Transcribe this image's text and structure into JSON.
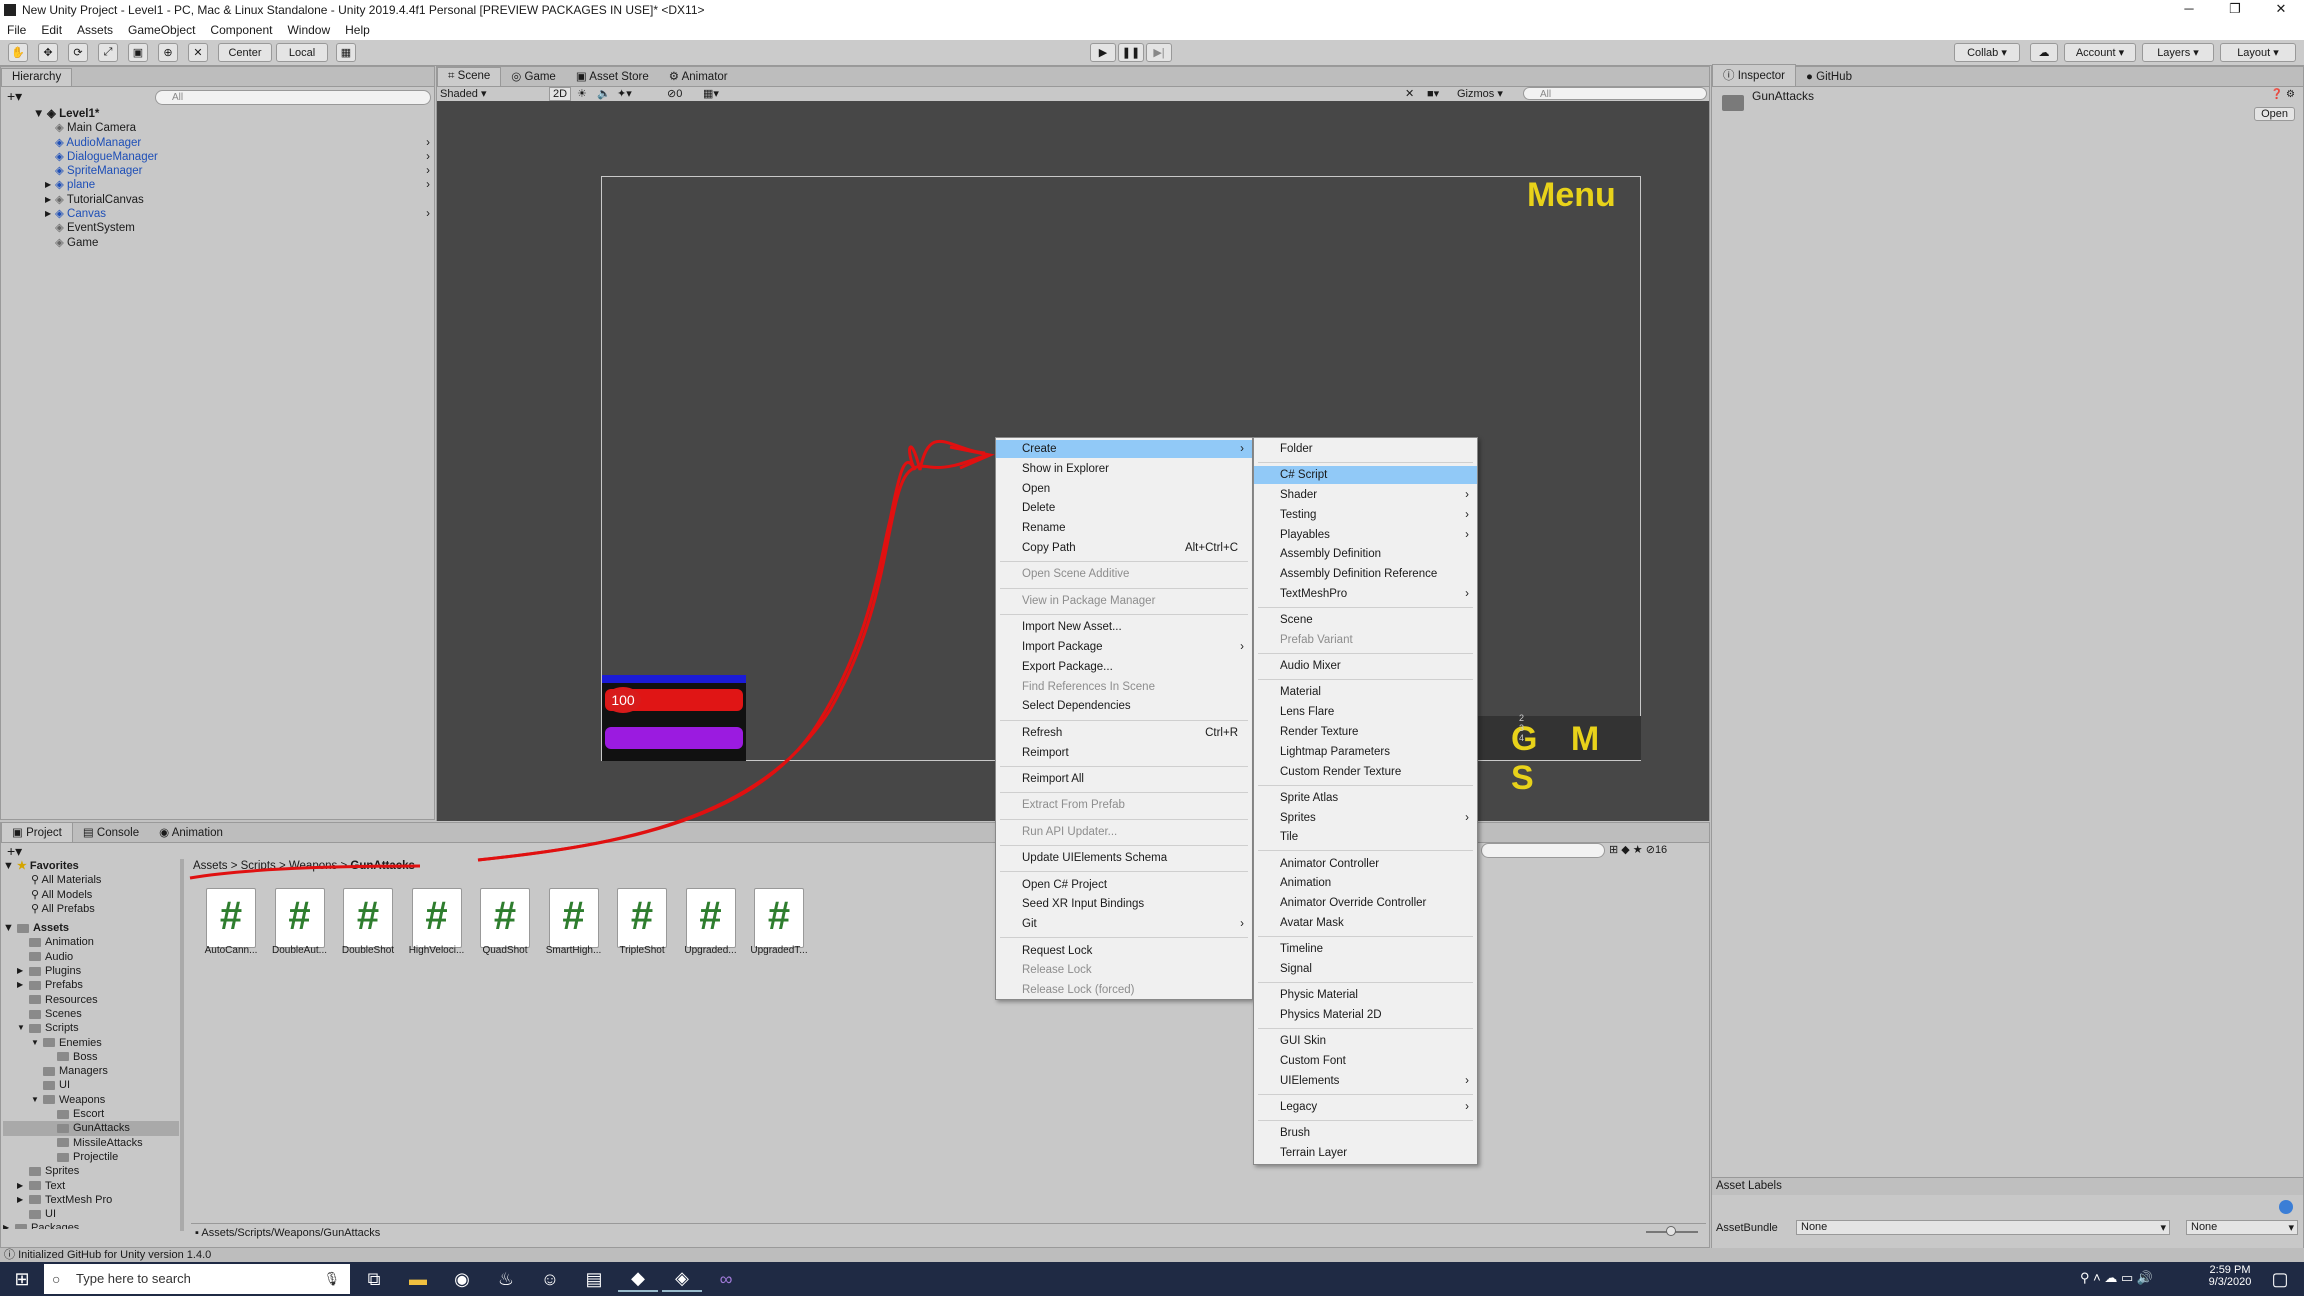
{
  "window": {
    "title": "New Unity Project - Level1 - PC, Mac & Linux Standalone - Unity 2019.4.4f1 Personal [PREVIEW PACKAGES IN USE]* <DX11>",
    "minimize": "─",
    "maximize": "❐",
    "close": "✕"
  },
  "menubar": [
    "File",
    "Edit",
    "Assets",
    "GameObject",
    "Component",
    "Window",
    "Help"
  ],
  "toolbar": {
    "center": "Center",
    "local": "Local",
    "collab": "Collab",
    "account": "Account",
    "layers": "Layers",
    "layout": "Layout"
  },
  "hierarchy": {
    "tab": "Hierarchy",
    "search_placeholder": "All",
    "scene": "Level1*",
    "items": [
      {
        "label": "Main Camera",
        "blue": false,
        "expander": false
      },
      {
        "label": "AudioManager",
        "blue": true,
        "expander": false
      },
      {
        "label": "DialogueManager",
        "blue": true,
        "expander": false
      },
      {
        "label": "SpriteManager",
        "blue": true,
        "expander": false
      },
      {
        "label": "plane",
        "blue": true,
        "expander": true
      },
      {
        "label": "TutorialCanvas",
        "blue": false,
        "expander": true
      },
      {
        "label": "Canvas",
        "blue": true,
        "expander": true
      },
      {
        "label": "EventSystem",
        "blue": false,
        "expander": false
      },
      {
        "label": "Game",
        "blue": false,
        "expander": false
      }
    ]
  },
  "scene_tabs": [
    "Scene",
    "Game",
    "Asset Store",
    "Animator"
  ],
  "scene_toolbar": {
    "shading": "Shaded",
    "mode": "2D",
    "gizmos": "Gizmos",
    "search": "All",
    "hidden_count": "0"
  },
  "scene": {
    "menu_label": "Menu",
    "health_value": "100",
    "buttons_text": "G M S",
    "tiny_numbers": "2 3 4"
  },
  "inspector": {
    "tabs": [
      "Inspector",
      "GitHub"
    ],
    "object": "GunAttacks",
    "open": "Open",
    "asset_labels": "Asset Labels",
    "asset_bundle": "AssetBundle",
    "bundle_value": "None",
    "variant_value": "None"
  },
  "project": {
    "tabs": [
      "Project",
      "Console",
      "Animation"
    ],
    "favorites": "Favorites",
    "fav_items": [
      "All Materials",
      "All Models",
      "All Prefabs"
    ],
    "assets": "Assets",
    "tree": [
      {
        "label": "Animation",
        "indent": 1
      },
      {
        "label": "Audio",
        "indent": 1
      },
      {
        "label": "Plugins",
        "indent": 1
      },
      {
        "label": "Prefabs",
        "indent": 1
      },
      {
        "label": "Resources",
        "indent": 1
      },
      {
        "label": "Scenes",
        "indent": 1
      },
      {
        "label": "Scripts",
        "indent": 1
      },
      {
        "label": "Enemies",
        "indent": 2
      },
      {
        "label": "Boss",
        "indent": 3
      },
      {
        "label": "Managers",
        "indent": 2
      },
      {
        "label": "UI",
        "indent": 2
      },
      {
        "label": "Weapons",
        "indent": 2
      },
      {
        "label": "Escort",
        "indent": 3
      },
      {
        "label": "GunAttacks",
        "indent": 3
      },
      {
        "label": "MissileAttacks",
        "indent": 3
      },
      {
        "label": "Projectile",
        "indent": 3
      },
      {
        "label": "Sprites",
        "indent": 1
      },
      {
        "label": "Text",
        "indent": 1
      },
      {
        "label": "TextMesh Pro",
        "indent": 1
      },
      {
        "label": "UI",
        "indent": 1
      },
      {
        "label": "Packages",
        "indent": 0
      }
    ],
    "breadcrumb": [
      "Assets",
      "Scripts",
      "Weapons",
      "GunAttacks"
    ],
    "files": [
      "AutoCann...",
      "DoubleAut...",
      "DoubleShot",
      "HighVeloci...",
      "QuadShot",
      "SmartHigh...",
      "TripleShot",
      "Upgraded...",
      "UpgradedT..."
    ],
    "path": "Assets/Scripts/Weapons/GunAttacks",
    "count": "16"
  },
  "status": "Initialized GitHub for Unity version 1.4.0",
  "context_menu": [
    {
      "label": "Create",
      "arrow": true,
      "hl": true
    },
    {
      "label": "Show in Explorer"
    },
    {
      "label": "Open"
    },
    {
      "label": "Delete"
    },
    {
      "label": "Rename"
    },
    {
      "label": "Copy Path",
      "shortcut": "Alt+Ctrl+C"
    },
    {
      "sep": true
    },
    {
      "label": "Open Scene Additive",
      "dis": true
    },
    {
      "sep": true
    },
    {
      "label": "View in Package Manager",
      "dis": true
    },
    {
      "sep": true
    },
    {
      "label": "Import New Asset..."
    },
    {
      "label": "Import Package",
      "arrow": true
    },
    {
      "label": "Export Package..."
    },
    {
      "label": "Find References In Scene",
      "dis": true
    },
    {
      "label": "Select Dependencies"
    },
    {
      "sep": true
    },
    {
      "label": "Refresh",
      "shortcut": "Ctrl+R"
    },
    {
      "label": "Reimport"
    },
    {
      "sep": true
    },
    {
      "label": "Reimport All"
    },
    {
      "sep": true
    },
    {
      "label": "Extract From Prefab",
      "dis": true
    },
    {
      "sep": true
    },
    {
      "label": "Run API Updater...",
      "dis": true
    },
    {
      "sep": true
    },
    {
      "label": "Update UIElements Schema"
    },
    {
      "sep": true
    },
    {
      "label": "Open C# Project"
    },
    {
      "label": "Seed XR Input Bindings"
    },
    {
      "label": "Git",
      "arrow": true
    },
    {
      "sep": true
    },
    {
      "label": "Request Lock"
    },
    {
      "label": "Release Lock",
      "dis": true
    },
    {
      "label": "Release Lock (forced)",
      "dis": true
    }
  ],
  "create_menu": [
    {
      "label": "Folder"
    },
    {
      "sep": true
    },
    {
      "label": "C# Script",
      "hl": true
    },
    {
      "label": "Shader",
      "arrow": true
    },
    {
      "label": "Testing",
      "arrow": true
    },
    {
      "label": "Playables",
      "arrow": true
    },
    {
      "label": "Assembly Definition"
    },
    {
      "label": "Assembly Definition Reference"
    },
    {
      "label": "TextMeshPro",
      "arrow": true
    },
    {
      "sep": true
    },
    {
      "label": "Scene"
    },
    {
      "label": "Prefab Variant",
      "dis": true
    },
    {
      "sep": true
    },
    {
      "label": "Audio Mixer"
    },
    {
      "sep": true
    },
    {
      "label": "Material"
    },
    {
      "label": "Lens Flare"
    },
    {
      "label": "Render Texture"
    },
    {
      "label": "Lightmap Parameters"
    },
    {
      "label": "Custom Render Texture"
    },
    {
      "sep": true
    },
    {
      "label": "Sprite Atlas"
    },
    {
      "label": "Sprites",
      "arrow": true
    },
    {
      "label": "Tile"
    },
    {
      "sep": true
    },
    {
      "label": "Animator Controller"
    },
    {
      "label": "Animation"
    },
    {
      "label": "Animator Override Controller"
    },
    {
      "label": "Avatar Mask"
    },
    {
      "sep": true
    },
    {
      "label": "Timeline"
    },
    {
      "label": "Signal"
    },
    {
      "sep": true
    },
    {
      "label": "Physic Material"
    },
    {
      "label": "Physics Material 2D"
    },
    {
      "sep": true
    },
    {
      "label": "GUI Skin"
    },
    {
      "label": "Custom Font"
    },
    {
      "label": "UIElements",
      "arrow": true
    },
    {
      "sep": true
    },
    {
      "label": "Legacy",
      "arrow": true
    },
    {
      "sep": true
    },
    {
      "label": "Brush"
    },
    {
      "label": "Terrain Layer"
    }
  ],
  "taskbar": {
    "search_placeholder": "Type here to search",
    "time": "2:59 PM",
    "date": "9/3/2020"
  },
  "colors": {
    "accent": "#91c9f7",
    "scene_bg": "#474747",
    "menu_yellow": "#e8d21a",
    "annotation": "#e01010"
  }
}
